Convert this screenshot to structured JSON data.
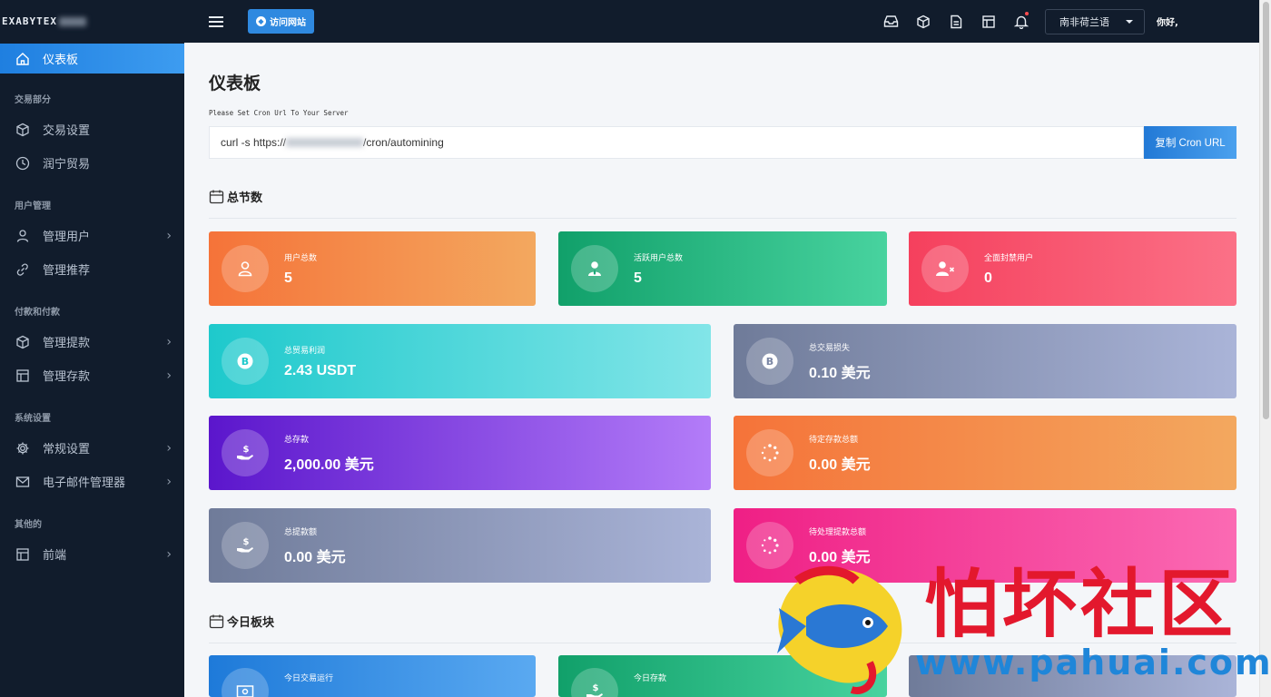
{
  "brand": "EXABYTEX",
  "topbar": {
    "visit_button": "访问网站",
    "language": "南非荷兰语",
    "greeting": "你好,"
  },
  "sidebar": {
    "dashboard": "仪表板",
    "sections": [
      {
        "heading": "交易部分",
        "items": [
          "交易设置",
          "润宁贸易"
        ]
      },
      {
        "heading": "用户管理",
        "items": [
          "管理用户",
          "管理推荐"
        ]
      },
      {
        "heading": "付款和付款",
        "items": [
          "管理提款",
          "管理存款"
        ]
      },
      {
        "heading": "系统设置",
        "items": [
          "常规设置",
          "电子邮件管理器"
        ]
      },
      {
        "heading": "其他的",
        "items": [
          "前端"
        ]
      }
    ]
  },
  "main": {
    "title": "仪表板",
    "cron_label": "Please Set Cron Url To Your Server",
    "cron_prefix": "curl -s https://",
    "cron_suffix": "/cron/automining",
    "copy_button": "复制 Cron URL",
    "section_total": "总节数",
    "section_today": "今日板块"
  },
  "cards": {
    "total_users": {
      "label": "用户总数",
      "value": "5"
    },
    "active_users": {
      "label": "活跃用户总数",
      "value": "5"
    },
    "banned_users": {
      "label": "全面封禁用户",
      "value": "0"
    },
    "trade_profit": {
      "label": "总贸易利润",
      "value": "2.43 USDT"
    },
    "trade_loss": {
      "label": "总交易损失",
      "value": "0.10 美元"
    },
    "total_deposit": {
      "label": "总存款",
      "value": "2,000.00 美元"
    },
    "pending_deposit": {
      "label": "待定存款总额",
      "value": "0.00 美元"
    },
    "total_withdraw": {
      "label": "总提款额",
      "value": "0.00 美元"
    },
    "pending_withdraw": {
      "label": "待处理提款总额",
      "value": "0.00 美元"
    },
    "today_trade": {
      "label": "今日交易运行"
    },
    "today_deposit": {
      "label": "今日存款"
    }
  },
  "watermark": {
    "text": "怕坏社区",
    "url": "www.pahuai.com"
  },
  "colors": {
    "sidebar_bg": "#111c2c",
    "accent": "#2f89e0",
    "watermark_red": "#e3182d",
    "watermark_blue": "#1f86d9"
  }
}
